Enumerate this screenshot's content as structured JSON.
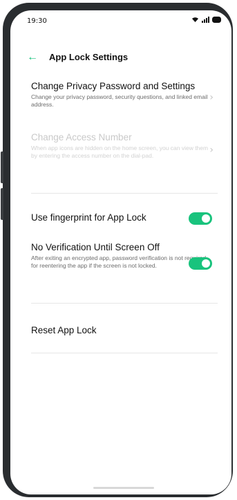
{
  "status_bar": {
    "time": "19:30"
  },
  "header": {
    "back_icon": "arrow-left-icon",
    "title": "App Lock Settings"
  },
  "items": [
    {
      "title": "Change Privacy Password and Settings",
      "desc": "Change your privacy password, security questions, and linked email address.",
      "disabled": false
    },
    {
      "title": "Change Access Number",
      "desc": "When app icons are hidden on the home screen, you can view them by entering the access number on the dial-pad.",
      "disabled": true
    },
    {
      "title": "Use fingerprint for App Lock",
      "toggle": true
    },
    {
      "title": "No Verification Until Screen Off",
      "desc": "After exiting an encrypted app, password verification is not required for reentering the app if the screen is not locked.",
      "toggle": true
    },
    {
      "title": "Reset App Lock"
    }
  ],
  "accent_color": "#19c37d"
}
